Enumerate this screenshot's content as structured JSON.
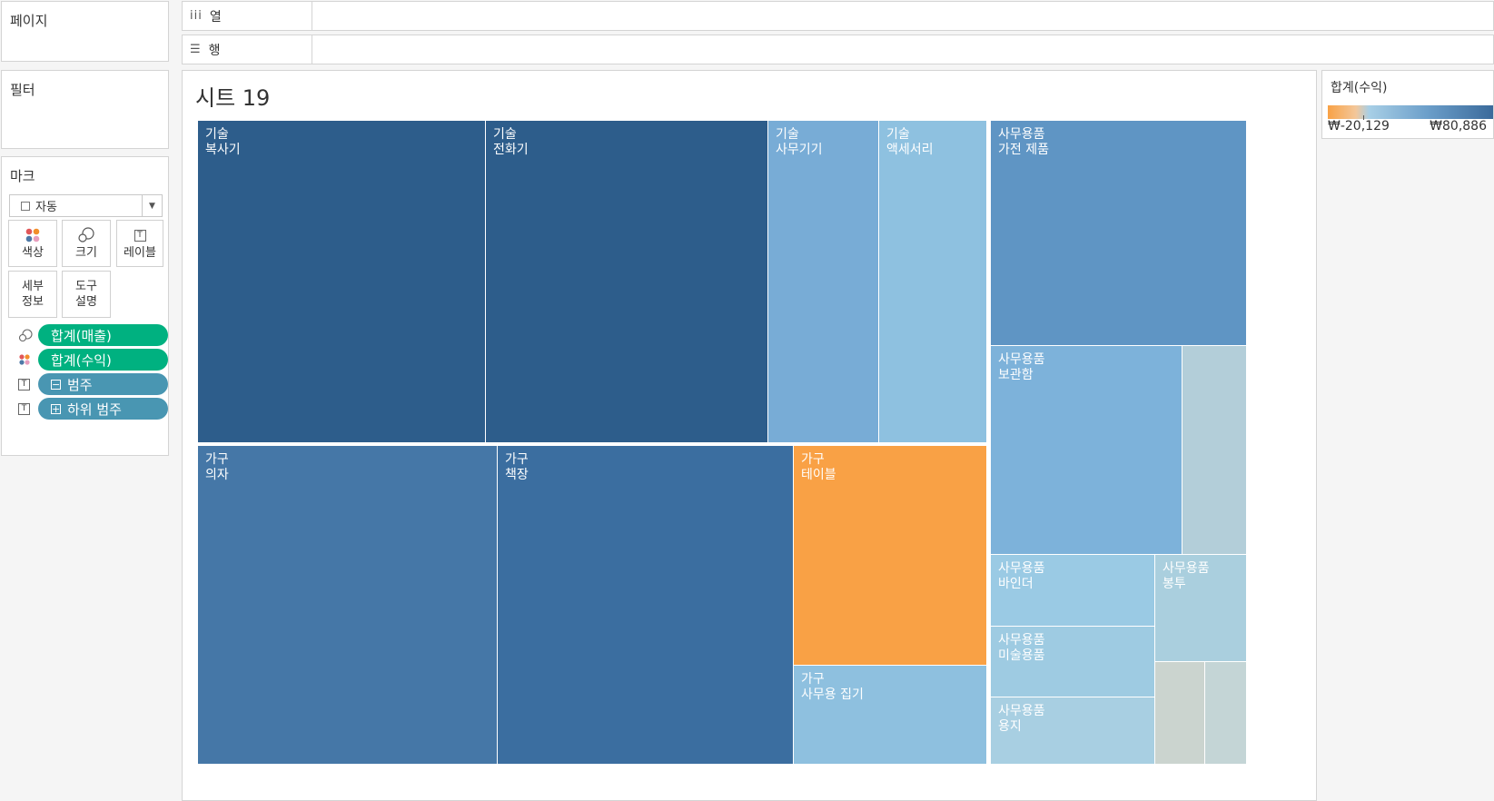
{
  "side": {
    "pages_label": "페이지",
    "filters_label": "필터",
    "marks_label": "마크",
    "mark_type": "자동",
    "buttons": {
      "color": "색상",
      "size": "크기",
      "label": "레이블",
      "detail_line1": "세부",
      "detail_line2": "정보",
      "tooltip_line1": "도구",
      "tooltip_line2": "설명"
    },
    "pills": [
      {
        "text": "합계(매출)",
        "kind": "size-icon",
        "color": "#00b180"
      },
      {
        "text": "합계(수익)",
        "kind": "color-icon",
        "color": "#00b180"
      },
      {
        "text": "범주",
        "kind": "label-icon",
        "toggle": "⊟",
        "color": "#4996b2"
      },
      {
        "text": "하위 범주",
        "kind": "label-icon",
        "toggle": "⊞",
        "color": "#4996b2"
      }
    ]
  },
  "shelves": {
    "columns_icon": "iii",
    "columns_label": "열",
    "rows_icon": "☰",
    "rows_label": "행"
  },
  "sheet": {
    "title": "시트 19"
  },
  "legend": {
    "title": "합계(수익)",
    "min": "₩-20,129",
    "max": "₩80,886",
    "min_color": "#f8a145",
    "max_color": "#2d5d8b"
  },
  "chart_data": {
    "type": "treemap",
    "size_measure": "합계(매출)",
    "color_measure": "합계(수익)",
    "color_range": [
      -20129,
      80886
    ],
    "cells": [
      {
        "category": "기술",
        "subcategory": "복사기",
        "color": "#2d5d8b"
      },
      {
        "category": "기술",
        "subcategory": "전화기",
        "color": "#2d5d8b"
      },
      {
        "category": "기술",
        "subcategory": "사무기기",
        "color": "#78acd6"
      },
      {
        "category": "기술",
        "subcategory": "액세서리",
        "color": "#8ec1e0"
      },
      {
        "category": "가구",
        "subcategory": "의자",
        "color": "#4577a7"
      },
      {
        "category": "가구",
        "subcategory": "책장",
        "color": "#3b6ea0"
      },
      {
        "category": "가구",
        "subcategory": "테이블",
        "color": "#f9a145"
      },
      {
        "category": "가구",
        "subcategory": "사무용 집기",
        "color": "#8ec0df"
      },
      {
        "category": "사무용품",
        "subcategory": "가전 제품",
        "color": "#5f95c4"
      },
      {
        "category": "사무용품",
        "subcategory": "보관함",
        "color": "#7db2da"
      },
      {
        "category": "사무용품",
        "subcategory": "",
        "color": "#b3ced9"
      },
      {
        "category": "사무용품",
        "subcategory": "바인더",
        "color": "#9acae4"
      },
      {
        "category": "사무용품",
        "subcategory": "봉투",
        "color": "#aacfde"
      },
      {
        "category": "사무용품",
        "subcategory": "미술용품",
        "color": "#9ecbe2"
      },
      {
        "category": "사무용품",
        "subcategory": "용지",
        "color": "#a8cfe2"
      },
      {
        "category": "사무용품",
        "subcategory": "",
        "color": "#cbd4cf"
      },
      {
        "category": "사무용품",
        "subcategory": "",
        "color": "#c4d5d6"
      }
    ]
  }
}
